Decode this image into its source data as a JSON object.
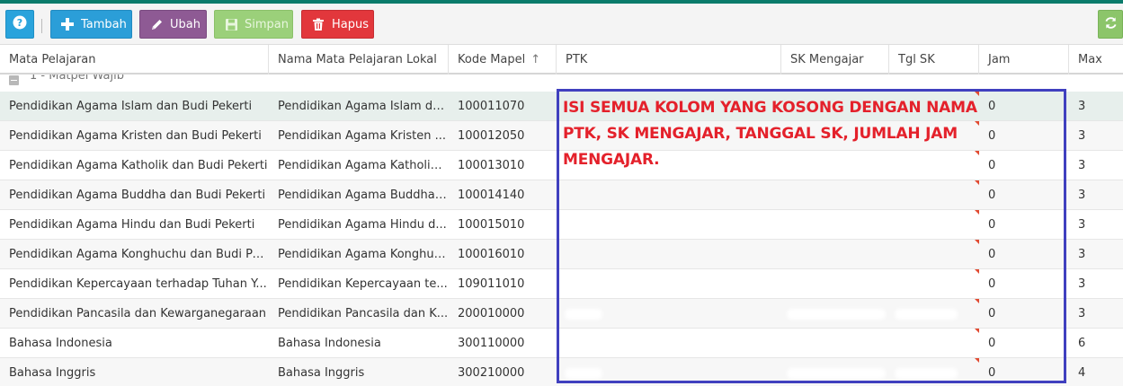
{
  "toolbar": {
    "help_icon": "question-circle-icon",
    "buttons": {
      "tambah": "Tambah",
      "ubah": "Ubah",
      "simpan": "Simpan",
      "hapus": "Hapus"
    },
    "refresh_icon": "refresh-icon"
  },
  "colors": {
    "topbar": "#0a7b6b",
    "tambah": "#2b9ed8",
    "ubah": "#8e5a94",
    "simpan": "#9bd07a",
    "hapus": "#e2373c",
    "refresh": "#8cc56a",
    "annotation_box": "#4040bf",
    "annotation_text": "#e4212b",
    "selected_row": "#e7efec"
  },
  "grid": {
    "columns": [
      "Mata Pelajaran",
      "Nama Mata Pelajaran Lokal",
      "Kode Mapel",
      "PTK",
      "SK Mengajar",
      "Tgl SK",
      "Jam",
      "Max"
    ],
    "sort_icon": "sort-asc-icon",
    "group": {
      "label": "1 - Matpel Wajib"
    },
    "rows": [
      {
        "mapel": "Pendidikan Agama Islam dan Budi Pekerti",
        "lokal": "Pendidikan Agama Islam da...",
        "kode": "100011070",
        "ptk": "",
        "sk": "",
        "tgl": "",
        "jam": "0",
        "max": "3"
      },
      {
        "mapel": "Pendidikan Agama Kristen dan Budi Pekerti",
        "lokal": "Pendidikan Agama Kristen ...",
        "kode": "100012050",
        "ptk": "",
        "sk": "",
        "tgl": "",
        "jam": "0",
        "max": "3"
      },
      {
        "mapel": "Pendidikan Agama Katholik dan Budi Pekerti",
        "lokal": "Pendidikan Agama Katholik ...",
        "kode": "100013010",
        "ptk": "",
        "sk": "",
        "tgl": "",
        "jam": "0",
        "max": "3"
      },
      {
        "mapel": "Pendidikan Agama Buddha dan Budi Pekerti",
        "lokal": "Pendidikan Agama Buddha ...",
        "kode": "100014140",
        "ptk": "",
        "sk": "",
        "tgl": "",
        "jam": "0",
        "max": "3"
      },
      {
        "mapel": "Pendidikan Agama Hindu dan Budi Pekerti",
        "lokal": "Pendidikan Agama Hindu d...",
        "kode": "100015010",
        "ptk": "",
        "sk": "",
        "tgl": "",
        "jam": "0",
        "max": "3"
      },
      {
        "mapel": "Pendidikan Agama Konghuchu dan Budi Pek...",
        "lokal": "Pendidikan Agama Konghuc...",
        "kode": "100016010",
        "ptk": "",
        "sk": "",
        "tgl": "",
        "jam": "0",
        "max": "3"
      },
      {
        "mapel": "Pendidikan Kepercayaan terhadap Tuhan Y...",
        "lokal": "Pendidikan Kepercayaan te...",
        "kode": "109011010",
        "ptk": "",
        "sk": "",
        "tgl": "",
        "jam": "0",
        "max": "3"
      },
      {
        "mapel": "Pendidikan Pancasila dan Kewarganegaraan",
        "lokal": "Pendidikan Pancasila dan K...",
        "kode": "200010000",
        "ptk": "",
        "sk": "",
        "tgl": "",
        "jam": "0",
        "max": "3"
      },
      {
        "mapel": "Bahasa Indonesia",
        "lokal": "Bahasa Indonesia",
        "kode": "300110000",
        "ptk": "",
        "sk": "",
        "tgl": "",
        "jam": "0",
        "max": "6"
      },
      {
        "mapel": "Bahasa Inggris",
        "lokal": "Bahasa Inggris",
        "kode": "300210000",
        "ptk": "",
        "sk": "",
        "tgl": "",
        "jam": "0",
        "max": "4"
      }
    ]
  },
  "annotation": {
    "text": "ISI SEMUA KOLOM YANG KOSONG DENGAN NAMA PTK, SK MENGAJAR, TANGGAL SK, JUMLAH JAM MENGAJAR."
  }
}
